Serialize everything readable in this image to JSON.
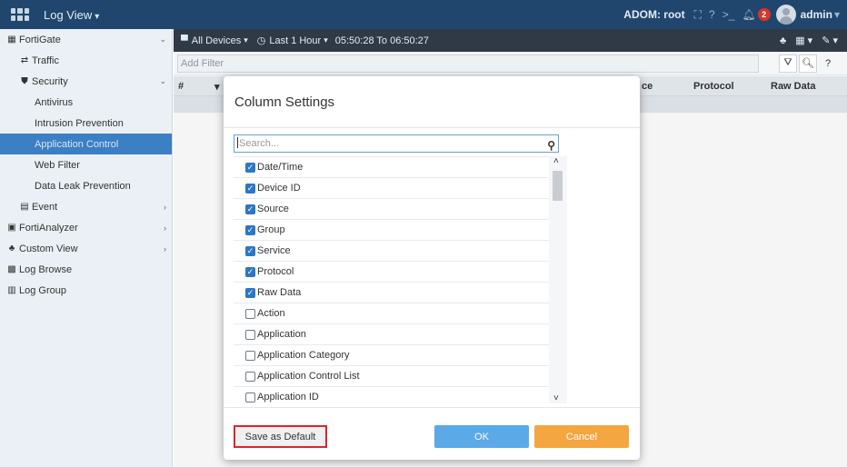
{
  "topbar": {
    "app_title": "Log View",
    "adom": "ADOM: root",
    "notification_count": "2",
    "user": "admin"
  },
  "sidebar": {
    "items": [
      {
        "label": "FortiGate",
        "icon": "fortigate-icon"
      },
      {
        "label": "Traffic",
        "icon": "traffic-icon"
      },
      {
        "label": "Security",
        "icon": "shield-icon"
      },
      {
        "label": "Antivirus"
      },
      {
        "label": "Intrusion Prevention"
      },
      {
        "label": "Application Control"
      },
      {
        "label": "Web Filter"
      },
      {
        "label": "Data Leak Prevention"
      },
      {
        "label": "Event",
        "icon": "event-icon"
      },
      {
        "label": "FortiAnalyzer",
        "icon": "fortianalyzer-icon"
      },
      {
        "label": "Custom View",
        "icon": "custom-view-icon"
      },
      {
        "label": "Log Browse",
        "icon": "log-browse-icon"
      },
      {
        "label": "Log Group",
        "icon": "log-group-icon"
      }
    ]
  },
  "toolbar": {
    "devices": "All Devices",
    "time_range": "Last 1 Hour",
    "time_span": "05:50:28 To 06:50:27"
  },
  "filter": {
    "placeholder": "Add Filter"
  },
  "table": {
    "columns": [
      "#",
      "Protocol",
      "Raw Data"
    ],
    "partial_col": "ce"
  },
  "modal": {
    "title": "Column Settings",
    "search_placeholder": "Search...",
    "columns": [
      {
        "label": "Date/Time",
        "checked": true
      },
      {
        "label": "Device ID",
        "checked": true
      },
      {
        "label": "Source",
        "checked": true
      },
      {
        "label": "Group",
        "checked": true
      },
      {
        "label": "Service",
        "checked": true
      },
      {
        "label": "Protocol",
        "checked": true
      },
      {
        "label": "Raw Data",
        "checked": true
      },
      {
        "label": "Action",
        "checked": false
      },
      {
        "label": "Application",
        "checked": false
      },
      {
        "label": "Application Category",
        "checked": false
      },
      {
        "label": "Application Control List",
        "checked": false
      },
      {
        "label": "Application ID",
        "checked": false
      }
    ],
    "save_default_label": "Save as Default",
    "ok_label": "OK",
    "cancel_label": "Cancel"
  },
  "colors": {
    "topbar": "#21466e",
    "sidebar_active": "#3b7fc4",
    "ok_button": "#5ba9e6",
    "cancel_button": "#f4a640",
    "highlight_border": "#d9262a"
  }
}
